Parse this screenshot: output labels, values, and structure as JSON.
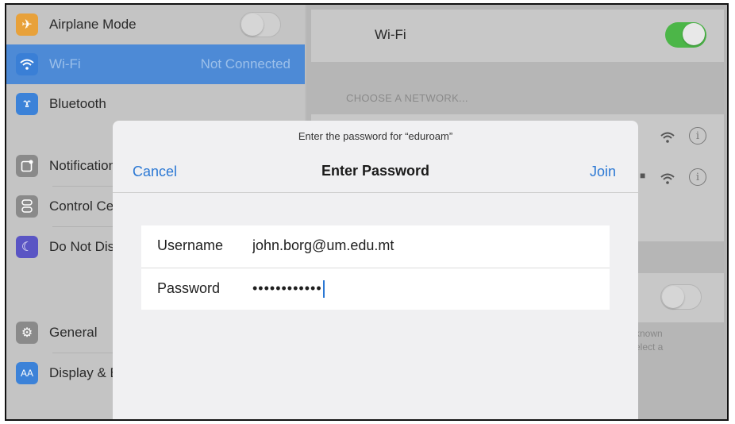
{
  "sidebar": {
    "items": [
      {
        "label": "Airplane Mode",
        "icon": "airplane-icon",
        "color": "#e8a13a"
      },
      {
        "label": "Wi-Fi",
        "value": "Not Connected",
        "icon": "wifi-icon",
        "color": "#3c82d8",
        "selected": true
      },
      {
        "label": "Bluetooth",
        "icon": "bluetooth-icon",
        "color": "#3c82d8"
      },
      {
        "label": "Notifications",
        "icon": "notifications-icon",
        "color": "#8a8a8a"
      },
      {
        "label": "Control Center",
        "icon": "control-center-icon",
        "color": "#8a8a8a"
      },
      {
        "label": "Do Not Disturb",
        "icon": "moon-icon",
        "color": "#5a55c4"
      },
      {
        "label": "General",
        "icon": "gear-icon",
        "color": "#8a8a8a"
      },
      {
        "label": "Display & Brightness",
        "icon": "display-icon",
        "color": "#3c82d8",
        "glyph": "AA"
      }
    ],
    "airplane_toggle_on": false
  },
  "detail": {
    "wifi_label": "Wi-Fi",
    "wifi_toggle_on": true,
    "section_title": "CHOOSE A NETWORK...",
    "footer_text_line1": "known",
    "footer_text_line2": "elect a"
  },
  "modal": {
    "prompt": "Enter the password for “eduroam”",
    "cancel_label": "Cancel",
    "title": "Enter Password",
    "join_label": "Join",
    "username_label": "Username",
    "username_value": "john.borg@um.edu.mt",
    "password_label": "Password",
    "password_mask": "••••••••••••"
  },
  "colors": {
    "accent": "#2b78d4",
    "toggle_on": "#4cb648"
  }
}
